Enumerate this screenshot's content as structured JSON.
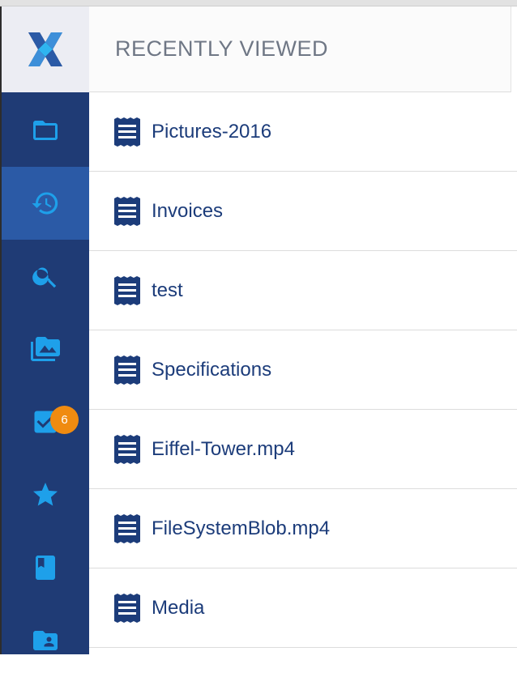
{
  "header": {
    "title": "RECENTLY VIEWED"
  },
  "sidebar": {
    "items": [
      {
        "icon": "folder-icon",
        "active": false
      },
      {
        "icon": "history-icon",
        "active": true
      },
      {
        "icon": "search-icon",
        "active": false
      },
      {
        "icon": "collections-icon",
        "active": false
      },
      {
        "icon": "tasks-icon",
        "active": false,
        "badge": "6"
      },
      {
        "icon": "star-icon",
        "active": false
      },
      {
        "icon": "book-icon",
        "active": false
      },
      {
        "icon": "user-folder-icon",
        "active": false
      }
    ]
  },
  "list": {
    "items": [
      {
        "label": "Pictures-2016",
        "icon": "document-icon"
      },
      {
        "label": "Invoices",
        "icon": "document-icon"
      },
      {
        "label": "test",
        "icon": "document-icon"
      },
      {
        "label": "Specifications",
        "icon": "document-icon"
      },
      {
        "label": "Eiffel-Tower.mp4",
        "icon": "document-icon"
      },
      {
        "label": "FileSystemBlob.mp4",
        "icon": "document-icon"
      },
      {
        "label": "Media",
        "icon": "document-icon"
      }
    ]
  },
  "colors": {
    "sidebar_bg": "#1f3b75",
    "sidebar_active": "#2b5aa6",
    "icon_blue": "#1ea0ea",
    "badge": "#f08b10",
    "item_text": "#1c3c7a",
    "header_text": "#6f7785"
  }
}
